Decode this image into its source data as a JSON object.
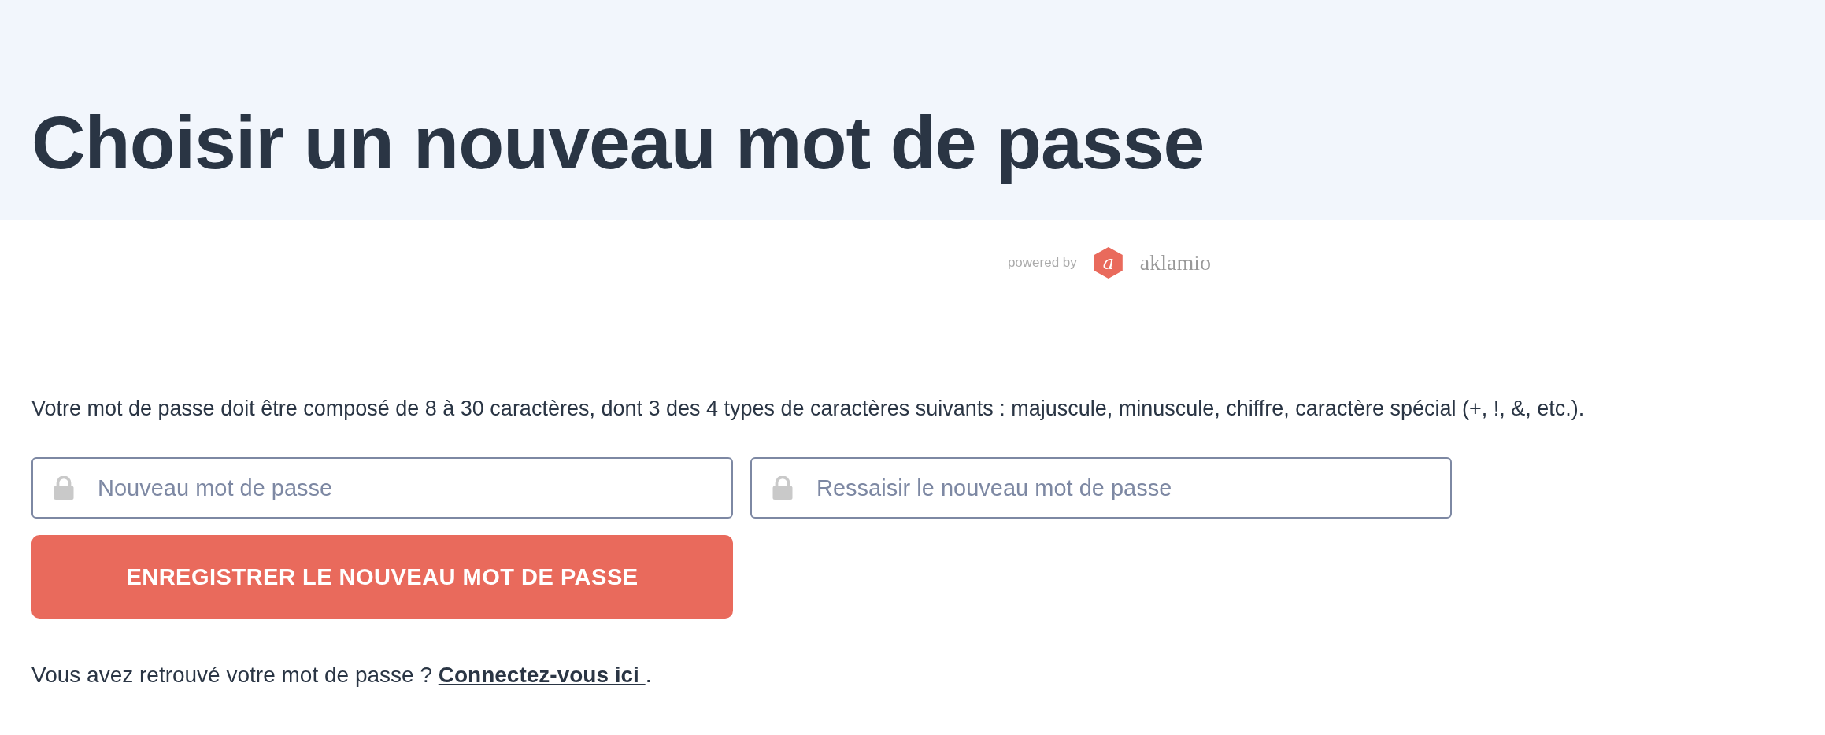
{
  "header": {
    "title": "Choisir un nouveau mot de passe"
  },
  "powered_by": {
    "label": "powered by",
    "logo_mark": "a",
    "brand": "aklamio"
  },
  "instructions": "Votre mot de passe doit être composé de 8 à 30 caractères, dont 3 des 4 types de caractères suivants : majuscule, minuscule, chiffre, caractère spécial (+, !, &, etc.).",
  "fields": [
    {
      "placeholder": "Nouveau mot de passe"
    },
    {
      "placeholder": "Ressaisir le nouveau mot de passe"
    }
  ],
  "submit_button": "ENREGISTRER LE NOUVEAU MOT DE PASSE",
  "login_prompt": {
    "text": "Vous avez retrouvé votre mot de passe ? ",
    "link": "Connectez-vous ici ",
    "suffix": "."
  }
}
